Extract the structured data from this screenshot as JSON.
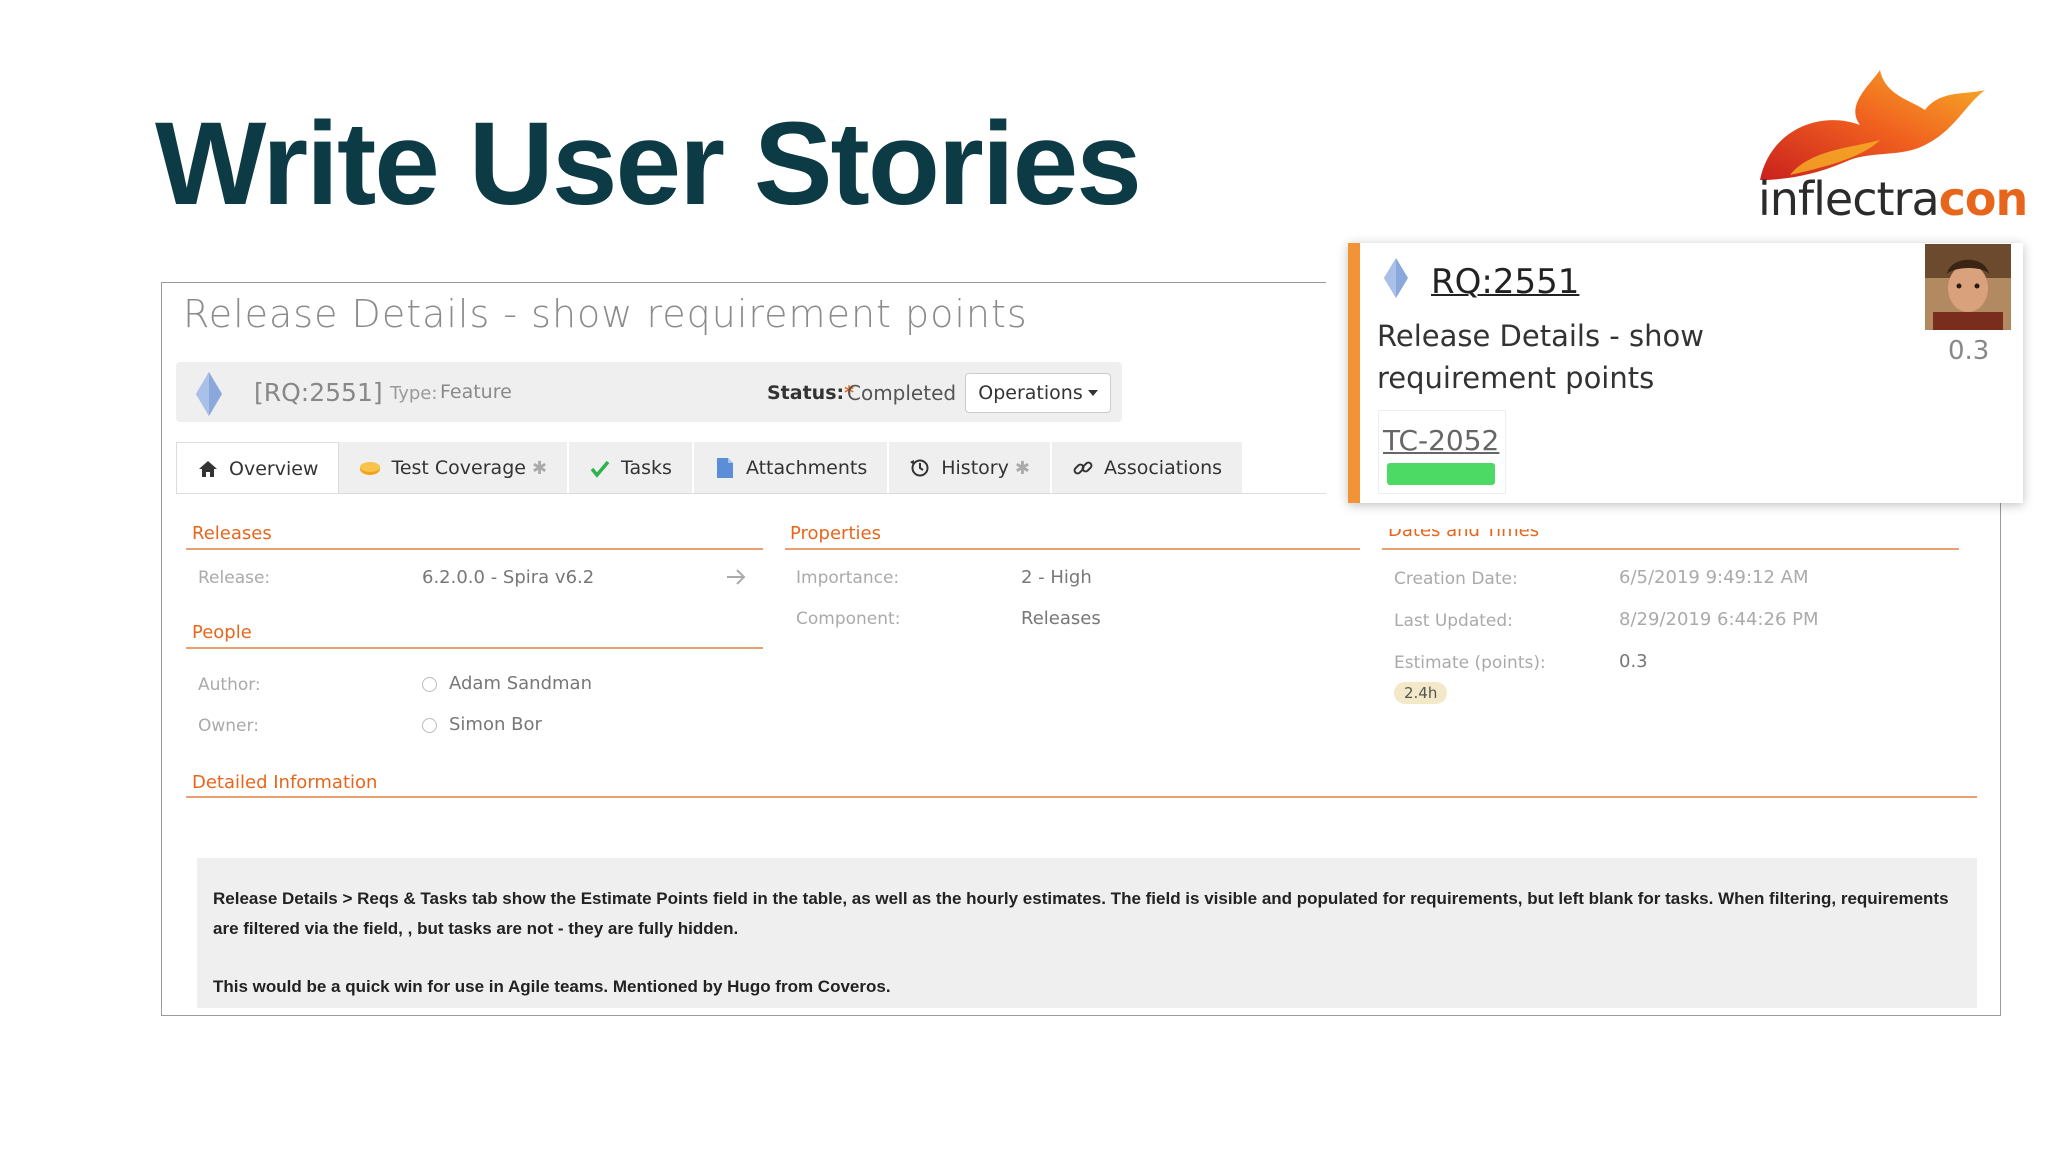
{
  "slide": {
    "title": "Write User Stories"
  },
  "logo": {
    "text_part1": "inflectra",
    "text_part2": "con",
    "accent_color": "#e8661c"
  },
  "requirement": {
    "title": "Release Details - show requirement points",
    "id": "[RQ:2551]",
    "type_label": "Type:",
    "type_value": "Feature",
    "status_label": "Status:",
    "status_required_mark": "*",
    "status_value": "Completed",
    "operations_label": "Operations"
  },
  "tabs": [
    {
      "label": "Overview",
      "icon": "home-icon",
      "active": true
    },
    {
      "label": "Test Coverage",
      "icon": "test-coverage-icon",
      "starred": true
    },
    {
      "label": "Tasks",
      "icon": "checkmark-icon"
    },
    {
      "label": "Attachments",
      "icon": "document-icon"
    },
    {
      "label": "History",
      "icon": "history-icon",
      "starred": true
    },
    {
      "label": "Associations",
      "icon": "link-icon"
    }
  ],
  "tab_star": "✱",
  "releases": {
    "heading": "Releases",
    "release_label": "Release:",
    "release_value": "6.2.0.0 - Spira v6.2"
  },
  "people": {
    "heading": "People",
    "author_label": "Author:",
    "author_value": "Adam Sandman",
    "owner_label": "Owner:",
    "owner_value": "Simon Bor"
  },
  "properties": {
    "heading": "Properties",
    "importance_label": "Importance:",
    "importance_value": "2 - High",
    "component_label": "Component:",
    "component_value": "Releases"
  },
  "dates": {
    "heading": "Dates and Times",
    "creation_label": "Creation Date:",
    "creation_value": "6/5/2019 9:49:12 AM",
    "updated_label": "Last Updated:",
    "updated_value": "8/29/2019 6:44:26 PM",
    "estimate_label": "Estimate (points):",
    "estimate_value": "0.3",
    "hours_badge": "2.4h"
  },
  "detailed": {
    "heading": "Detailed Information",
    "paragraph1": "Release Details > Reqs & Tasks tab show the Estimate Points field in the table, as well as the hourly estimates. The field is visible and populated for requirements, but left blank for tasks. When filtering, requirements are filtered via the field, , but tasks are not - they are fully hidden.",
    "paragraph2": "This would be a quick win for use in Agile teams. Mentioned by Hugo from Coveros."
  },
  "card": {
    "id": "RQ:2551",
    "title": "Release Details - show requirement points",
    "estimate": "0.3",
    "test_case": "TC-2052",
    "accent_color": "#f19336",
    "progress_color": "#4cd964"
  }
}
